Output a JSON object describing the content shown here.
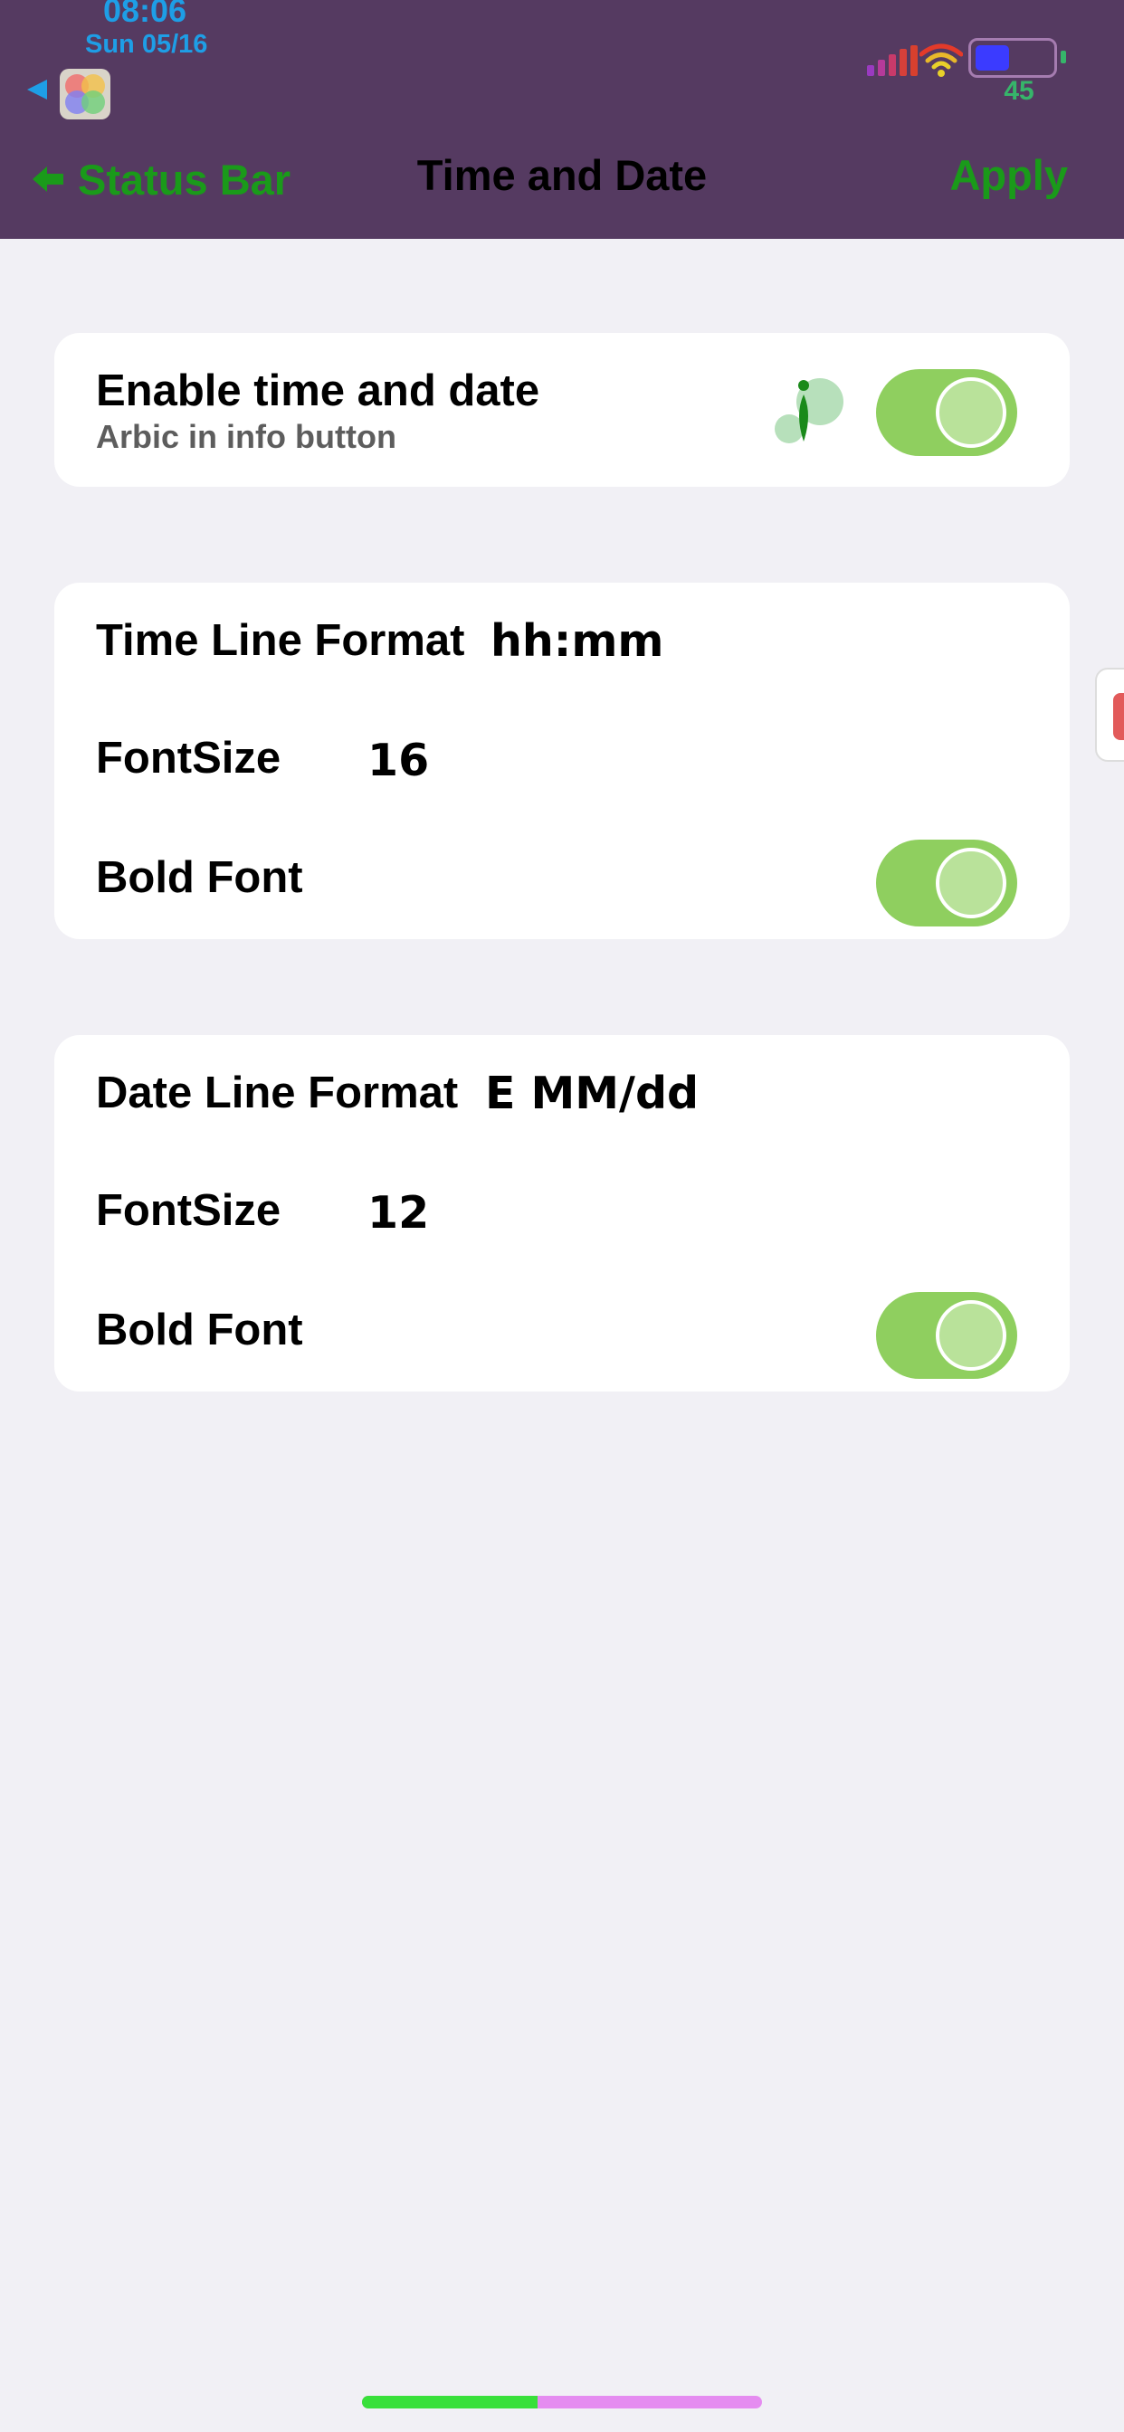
{
  "status_bar": {
    "time": "08:06",
    "date": "Sun 05/16",
    "battery_level": "45",
    "battery_fill_fraction": 0.42,
    "icons": [
      "back-arrow-icon",
      "app-icon",
      "signal-icon",
      "wifi-icon",
      "battery-icon"
    ]
  },
  "nav": {
    "back_label": "Status Bar",
    "title": "Time and Date",
    "apply_label": "Apply"
  },
  "enable_card": {
    "title": "Enable time and date",
    "subtitle": "Arbic in info button",
    "enabled": true
  },
  "time_card": {
    "format_label": "Time Line Format",
    "format_value": "hh:mm",
    "fontsize_label": "FontSize",
    "fontsize_value": "16",
    "bold_label": "Bold Font",
    "bold_enabled": true
  },
  "date_card": {
    "format_label": "Date Line Format",
    "format_value": "E MM/dd",
    "fontsize_label": "FontSize",
    "fontsize_value": "12",
    "bold_label": "Bold Font",
    "bold_enabled": true
  },
  "home_indicator": {
    "progress_fraction": 0.44
  },
  "colors": {
    "header_bg": "#553a61",
    "accent_green": "#1a9a1a",
    "toggle_on": "#8fcf5f",
    "clock_blue": "#1e9ee6",
    "page_bg": "#f1f0f5"
  }
}
